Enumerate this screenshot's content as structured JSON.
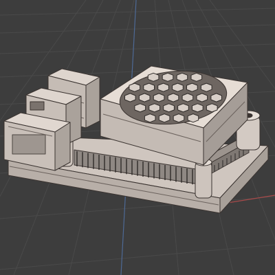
{
  "viewport": {
    "mode": "3d-viewport",
    "shading": "solid-with-wireframe-overlay",
    "colors": {
      "background": "#3d3d3d",
      "grid_line": "#4a4a4a",
      "axis_x": "#a94a4a",
      "axis_y": "#4e6a96",
      "model_face": "#d9d0c8",
      "model_face_shade": "#b7aea7",
      "model_edge": "#3a3330"
    }
  },
  "model": {
    "parts": [
      "base-plate",
      "heatsink-block",
      "fan-grille",
      "usb-port-stack",
      "ethernet-port",
      "gpio-header",
      "ribbon-connector",
      "mounting-standoff"
    ]
  }
}
